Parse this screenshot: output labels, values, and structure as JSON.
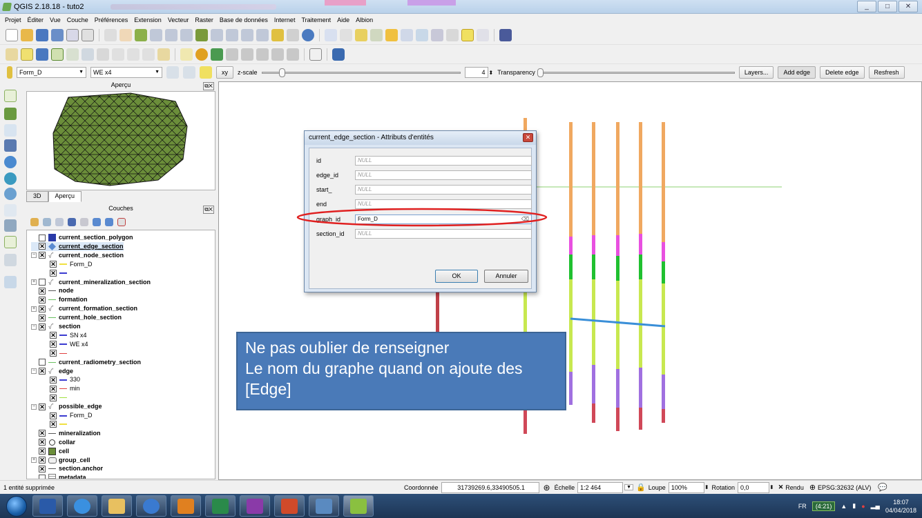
{
  "window": {
    "title": "QGIS 2.18.18 - tuto2",
    "controls": [
      "_",
      "□",
      "✕"
    ]
  },
  "menu": [
    "Projet",
    "Éditer",
    "Vue",
    "Couche",
    "Préférences",
    "Extension",
    "Vecteur",
    "Raster",
    "Base de données",
    "Internet",
    "Traitement",
    "Aide",
    "Albion"
  ],
  "toolbar3": {
    "graph_combo": "Form_D",
    "section_combo": "WE x4",
    "xy_label": "xy",
    "zscale_label": "z-scale",
    "zscale_value": "4",
    "zscale_level": 0.1,
    "transparency_label": "Transparency",
    "transparency_level": 0,
    "layers_button": "Layers...",
    "add_edge_button": "Add edge",
    "delete_edge_button": "Delete edge",
    "refresh_button": "Resfresh"
  },
  "panels": {
    "apercu_title": "Aperçu",
    "tab_3d": "3D",
    "tab_apercu": "Aperçu",
    "couches_title": "Couches"
  },
  "layers": [
    {
      "label": "current_section_polygon",
      "checked": false,
      "bold": true,
      "symbol": "fill-blue"
    },
    {
      "label": "current_edge_section",
      "checked": true,
      "bold": true,
      "symbol": "edit-icon",
      "underline": true
    },
    {
      "label": "current_node_section",
      "checked": true,
      "bold": true,
      "symbol": "rule-icon",
      "expand": "-"
    },
    {
      "label": "Form_D",
      "checked": true,
      "bold": false,
      "symbol": "line-yellow",
      "indent": 1
    },
    {
      "label": "",
      "checked": true,
      "bold": false,
      "symbol": "line-blue",
      "indent": 1
    },
    {
      "label": "current_mineralization_section",
      "checked": false,
      "bold": true,
      "symbol": "rule-icon",
      "expand": "+"
    },
    {
      "label": "node",
      "checked": true,
      "bold": true,
      "symbol": "line-gray"
    },
    {
      "label": "formation",
      "checked": true,
      "bold": true,
      "symbol": "line-green"
    },
    {
      "label": "current_formation_section",
      "checked": true,
      "bold": true,
      "symbol": "rule-icon",
      "expand": "+"
    },
    {
      "label": "current_hole_section",
      "checked": true,
      "bold": true,
      "symbol": "line-green"
    },
    {
      "label": "section",
      "checked": true,
      "bold": true,
      "symbol": "rule-icon",
      "expand": "-"
    },
    {
      "label": "SN x4",
      "checked": true,
      "bold": false,
      "symbol": "line-blue",
      "indent": 1
    },
    {
      "label": "WE x4",
      "checked": true,
      "bold": false,
      "symbol": "line-blue",
      "indent": 1
    },
    {
      "label": "",
      "checked": true,
      "bold": false,
      "symbol": "line-red",
      "indent": 1
    },
    {
      "label": "current_radiometry_section",
      "checked": false,
      "bold": true,
      "symbol": "line-green"
    },
    {
      "label": "edge",
      "checked": true,
      "bold": true,
      "symbol": "rule-icon",
      "expand": "-"
    },
    {
      "label": "330",
      "checked": true,
      "bold": false,
      "symbol": "line-blue",
      "indent": 1
    },
    {
      "label": "min",
      "checked": true,
      "bold": false,
      "symbol": "line-red",
      "indent": 1
    },
    {
      "label": "",
      "checked": true,
      "bold": false,
      "symbol": "line-lime",
      "indent": 1
    },
    {
      "label": "possible_edge",
      "checked": true,
      "bold": true,
      "symbol": "rule-icon",
      "expand": "-"
    },
    {
      "label": "Form_D",
      "checked": true,
      "bold": false,
      "symbol": "line-blue",
      "indent": 1
    },
    {
      "label": "",
      "checked": true,
      "bold": false,
      "symbol": "line-yellow",
      "indent": 1
    },
    {
      "label": "mineralization",
      "checked": true,
      "bold": true,
      "symbol": "line-gray"
    },
    {
      "label": "collar",
      "checked": true,
      "bold": true,
      "symbol": "circle"
    },
    {
      "label": "cell",
      "checked": true,
      "bold": true,
      "symbol": "fill-green"
    },
    {
      "label": "group_cell",
      "checked": true,
      "bold": true,
      "symbol": "group-icon",
      "expand": "+"
    },
    {
      "label": "section.anchor",
      "checked": true,
      "bold": true,
      "symbol": "line-gray"
    },
    {
      "label": "metadata",
      "checked": false,
      "bold": true,
      "symbol": "table-icon"
    }
  ],
  "dialog": {
    "title": "current_edge_section - Attributs d'entités",
    "fields": [
      {
        "label": "id",
        "value": "NULL",
        "is_null": true
      },
      {
        "label": "edge_id",
        "value": "NULL",
        "is_null": true
      },
      {
        "label": "start_",
        "value": "NULL",
        "is_null": true
      },
      {
        "label": "end",
        "value": "NULL",
        "is_null": true
      },
      {
        "label": "graph_id",
        "value": "Form_D",
        "is_null": false
      },
      {
        "label": "section_id",
        "value": "NULL",
        "is_null": true
      }
    ],
    "ok_button": "OK",
    "cancel_button": "Annuler"
  },
  "callout": {
    "lines": [
      "Ne pas oublier de renseigner",
      "Le nom du graphe quand on ajoute des",
      "[Edge]"
    ],
    "color": "#4a7ab8"
  },
  "statusbar": {
    "message": "1 entité supprimée",
    "coord_label": "Coordonnée",
    "coord_value": "31739269.6,33490505.1",
    "scale_label": "Échelle",
    "scale_value": "1:2 464",
    "zoom_label": "Loupe",
    "zoom_value": "100%",
    "rotation_label": "Rotation",
    "rotation_value": "0,0",
    "render_label": "Rendu",
    "crs": "EPSG:32632 (ALV)"
  },
  "taskbar": {
    "lang": "FR",
    "battery": "(4:21)",
    "time": "18:07",
    "date": "04/04/2018"
  },
  "colors": {
    "accent_red": "#e02020",
    "edge_blue": "#3a8fd8",
    "polygon_green": "#6b8e3a"
  }
}
